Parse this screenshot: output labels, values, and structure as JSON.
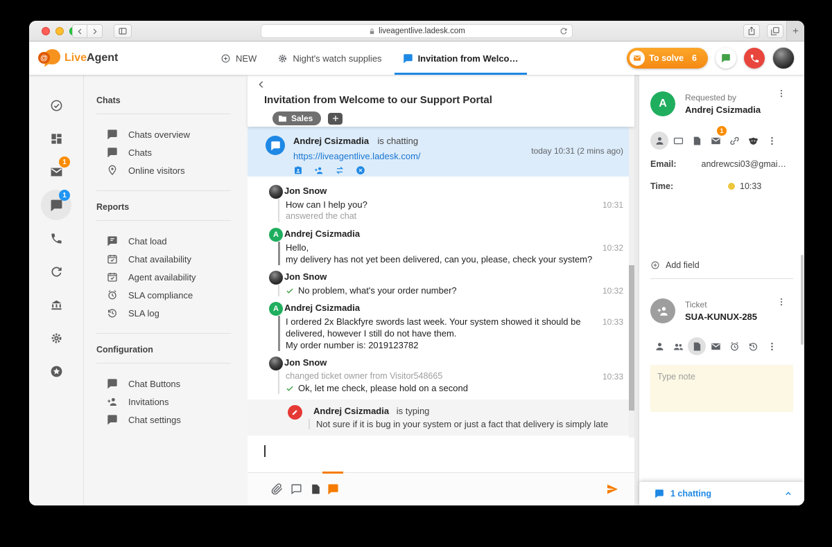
{
  "browser": {
    "url": "liveagentlive.ladesk.com"
  },
  "header": {
    "brand": {
      "live": "Live",
      "agent": "Agent"
    },
    "tabs": [
      {
        "label": "NEW"
      },
      {
        "label": "Night's watch supplies"
      },
      {
        "label": "Invitation from Welco…"
      }
    ],
    "to_solve": {
      "label": "To solve",
      "count": "6"
    }
  },
  "rail": {
    "mail_badge": "1",
    "chat_badge": "1"
  },
  "menu": {
    "sections": [
      {
        "title": "Chats",
        "items": [
          {
            "label": "Chats overview"
          },
          {
            "label": "Chats"
          },
          {
            "label": "Online visitors"
          }
        ]
      },
      {
        "title": "Reports",
        "items": [
          {
            "label": "Chat load"
          },
          {
            "label": "Chat availability"
          },
          {
            "label": "Agent availability"
          },
          {
            "label": "SLA compliance"
          },
          {
            "label": "SLA log"
          }
        ]
      },
      {
        "title": "Configuration",
        "items": [
          {
            "label": "Chat Buttons"
          },
          {
            "label": "Invitations"
          },
          {
            "label": "Chat settings"
          }
        ]
      }
    ]
  },
  "chat": {
    "title": "Invitation from Welcome to our Support Portal",
    "tag": "Sales",
    "banner": {
      "name": "Andrej Csizmadia",
      "status": "is chatting",
      "link": "https://liveagentlive.ladesk.com/",
      "time": "today 10:31 (2 mins ago)"
    },
    "messages": [
      {
        "author": "Jon Snow",
        "time": "10:31",
        "line1": "How can I help you?",
        "line2": "answered the chat"
      },
      {
        "author": "Andrej Csizmadia",
        "time": "10:32",
        "line1": "Hello,",
        "line2": "my delivery has not yet been delivered, can you, please, check your system?"
      },
      {
        "author": "Jon Snow",
        "time": "10:32",
        "line1": "No problem, what's your order number?"
      },
      {
        "author": "Andrej Csizmadia",
        "time": "10:33",
        "line1": "I ordered 2x Blackfyre swords last week. Your system showed it should be delivered, however I still do not have them.",
        "line2": "My order number is: 2019123782"
      },
      {
        "author": "Jon Snow",
        "time": "10:33",
        "line1": "changed ticket owner from Visitor548665",
        "line2": "Ok, let me check, please hold on a second"
      }
    ],
    "typing": {
      "name": "Andrej Csizmadia",
      "status": "is typing",
      "text": "Not sure if it is bug in your system or just a fact that delivery is simply late"
    }
  },
  "right": {
    "requested_by_label": "Requested by",
    "requested_by_name": "Andrej Csizmadia",
    "avatar_initial": "A",
    "mail_badge": "1",
    "email_label": "Email:",
    "email_value": "andrewcsi03@gmai…",
    "time_label": "Time:",
    "time_value": "10:33",
    "add_field_label": "Add field",
    "ticket_label": "Ticket",
    "ticket_id": "SUA-KUNUX-285",
    "note_placeholder": "Type note",
    "chatting_label": "1 chatting"
  }
}
